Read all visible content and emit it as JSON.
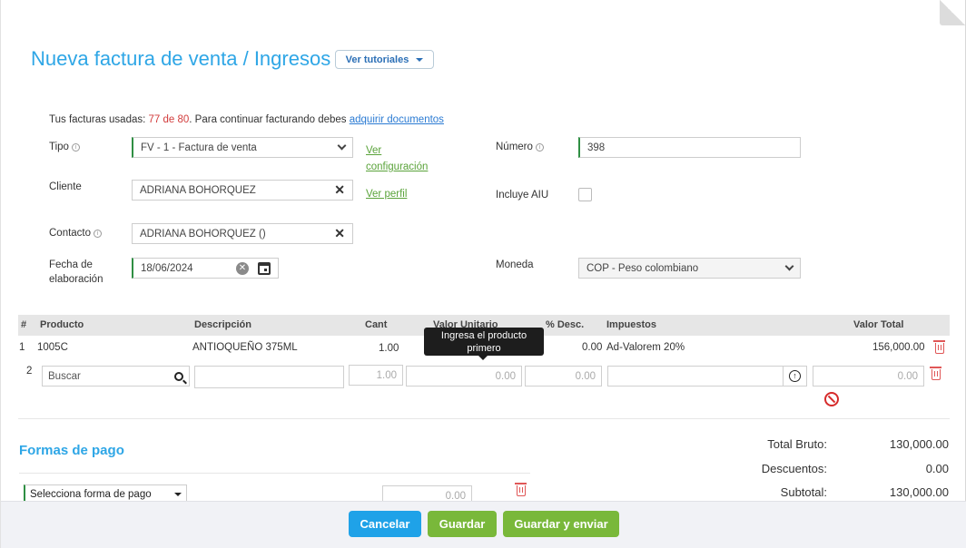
{
  "header": {
    "title": "Nueva factura de venta / Ingresos",
    "tutorials_label": "Ver tutoriales"
  },
  "notice": {
    "prefix": "Tus facturas usadas: ",
    "count": "77 de 80",
    "middle": ". Para continuar facturando debes ",
    "link": "adquirir documentos"
  },
  "form": {
    "tipo_label": "Tipo",
    "tipo_value": "FV - 1 - Factura de venta",
    "ver_config_1": "Ver",
    "ver_config_2": "configuración",
    "numero_label": "Número",
    "numero_value": "398",
    "cliente_label": "Cliente",
    "cliente_value": "ADRIANA BOHORQUEZ",
    "ver_perfil": "Ver perfil",
    "aiu_label": "Incluye AIU",
    "contacto_label": "Contacto",
    "contacto_value": "ADRIANA BOHORQUEZ ()",
    "fecha_label_1": "Fecha de",
    "fecha_label_2": "elaboración",
    "fecha_value": "18/06/2024",
    "moneda_label": "Moneda",
    "moneda_value": "COP - Peso colombiano"
  },
  "table": {
    "headers": {
      "num": "#",
      "producto": "Producto",
      "descripcion": "Descripción",
      "cant": "Cant",
      "valor_unitario": "Valor Unitario",
      "desc": "% Desc.",
      "impuestos": "Impuestos",
      "valor_total": "Valor Total"
    },
    "row1": {
      "num": "1",
      "producto": "1005C",
      "descripcion": "ANTIOQUEÑO 375ML",
      "cant": "1.00",
      "desc": "0.00",
      "impuestos": "Ad-Valorem 20%",
      "valor_total": "156,000.00"
    },
    "row2": {
      "num": "2",
      "buscar_placeholder": "Buscar",
      "cant": "1.00",
      "valor_unitario": "0.00",
      "desc": "0.00",
      "valor_total": "0.00"
    },
    "tooltip_line1": "Ingresa el producto",
    "tooltip_line2": "primero"
  },
  "payments": {
    "title": "Formas de pago",
    "select_label": "Selecciona forma de pago",
    "amount": "0.00"
  },
  "totals": {
    "bruto_label": "Total Bruto:",
    "bruto_value": "130,000.00",
    "descuentos_label": "Descuentos:",
    "descuentos_value": "0.00",
    "subtotal_label": "Subtotal:",
    "subtotal_value": "130,000.00"
  },
  "footer": {
    "cancel": "Cancelar",
    "save": "Guardar",
    "save_send": "Guardar y enviar"
  },
  "colors": {
    "accent": "#2ea6e6",
    "green": "#79b83a",
    "danger": "#e05757"
  }
}
